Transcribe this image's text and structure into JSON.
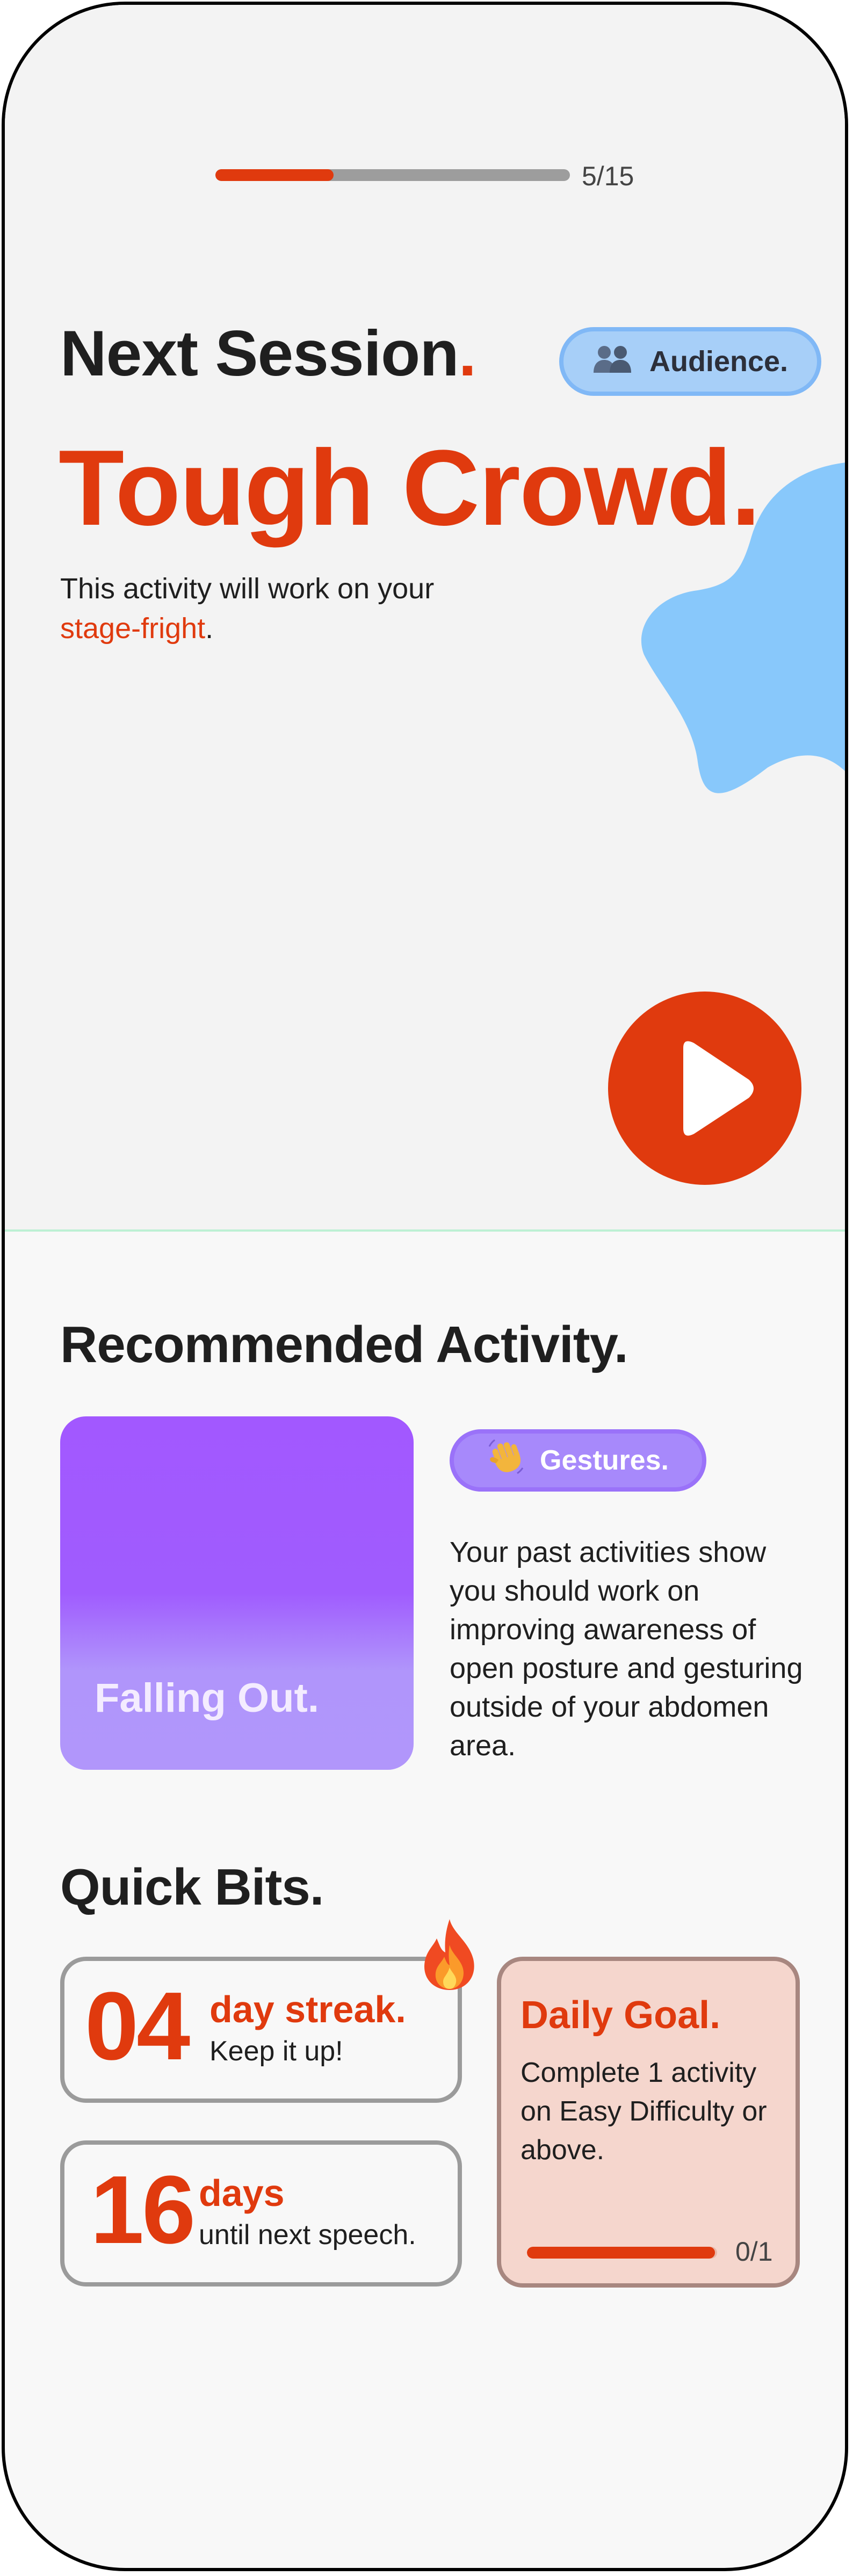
{
  "progress": {
    "current": 5,
    "total": 15,
    "label": "5/15",
    "fill_fraction": 0.333
  },
  "next_session": {
    "label": "Next Session",
    "label_dot": ".",
    "category_badge": "Audience.",
    "category_icon": "people-icon",
    "title": "Tough Crowd.",
    "description_prefix": "This activity will work on your",
    "description_accent": "stage-fright",
    "description_suffix": "."
  },
  "play": {
    "icon": "play-icon"
  },
  "recommended": {
    "heading": "Recommended Activity.",
    "card_title": "Falling Out.",
    "tag": "Gestures.",
    "tag_icon": "waving-hand-icon",
    "description": "Your past activities show you should work on improving awareness of open posture and gesturing outside of your abdomen area."
  },
  "quick_bits": {
    "heading": "Quick Bits.",
    "streak": {
      "number": "04",
      "title": "day streak.",
      "subtitle": "Keep it up!",
      "icon": "fire-icon"
    },
    "countdown": {
      "number": "16",
      "title": "days",
      "subtitle": "until next speech."
    },
    "daily_goal": {
      "title": "Daily Goal.",
      "description": "Complete 1 activity on Easy Difficulty or above.",
      "progress_label": "0/1",
      "progress_fraction": 0.99
    }
  },
  "colors": {
    "accent": "#e03a0e",
    "audience_badge": "#a7cff8",
    "activity_card": "#a258ff",
    "gestures_badge": "#a789fb",
    "daily_goal_bg": "#f5d6cd",
    "blob": "#88c8fb"
  }
}
